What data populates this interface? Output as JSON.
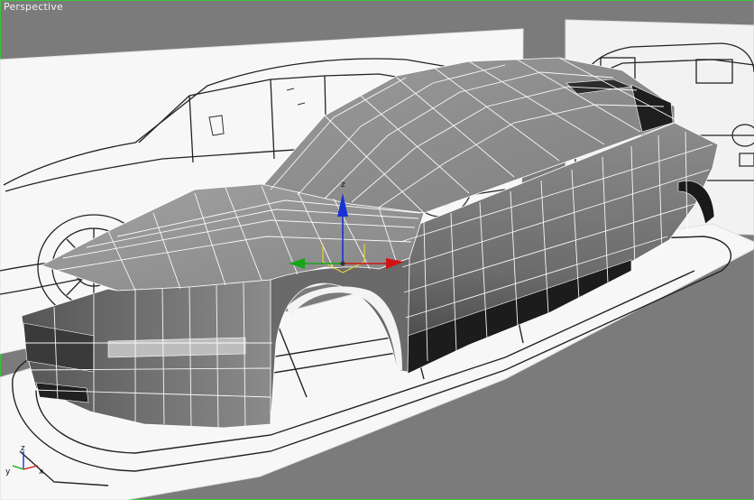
{
  "viewport": {
    "label": "Perspective"
  },
  "transform_gizmo": {
    "axes": [
      "x",
      "y",
      "z"
    ],
    "z_label": "z"
  },
  "view_axis_tripod": {
    "x_label": "x",
    "y_label": "y",
    "z_label": "z"
  },
  "colors": {
    "viewport_background": "#7b7b7b",
    "viewport_border": "#39c33a",
    "x_axis": "#d01414",
    "y_axis": "#17a617",
    "z_axis": "#1733d6",
    "selection_bracket": "#e8d33a",
    "mesh_face": "#8a8a8a",
    "mesh_wire": "#ffffff"
  }
}
